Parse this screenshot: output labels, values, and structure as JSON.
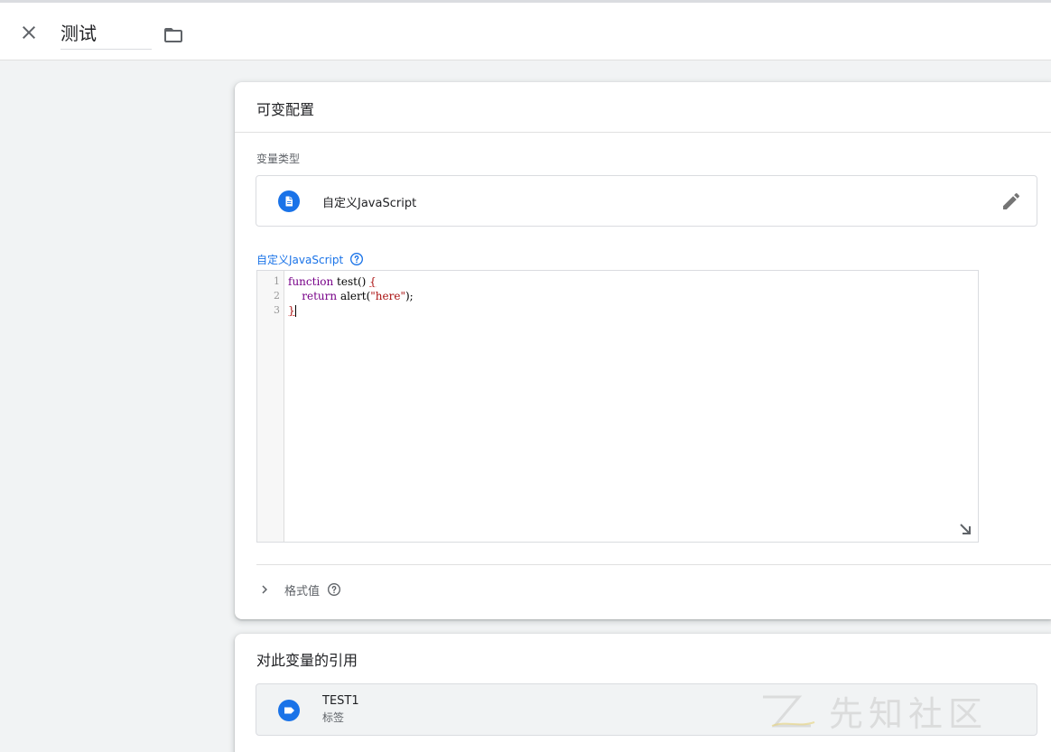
{
  "header": {
    "title_value": "测试",
    "close_icon": "close-icon",
    "folder_icon": "folder-icon"
  },
  "config_card": {
    "title": "可变配置",
    "variable_type_label": "变量类型",
    "variable_type_name": "自定义JavaScript",
    "type_icon": "document-icon",
    "edit_icon": "pencil-icon",
    "js_label": "自定义JavaScript",
    "help_icon": "help-icon",
    "code": {
      "line_numbers": [
        "1",
        "2",
        "3"
      ],
      "line1_fn": "function",
      "line1_name": " test() ",
      "line1_brace": "{",
      "line2_indent": "    ",
      "line2_return": "return",
      "line2_call": " alert(",
      "line2_string": "\"here\"",
      "line2_end": ");",
      "line3_brace": "}"
    },
    "format_label": "格式值"
  },
  "references_card": {
    "title": "对此变量的引用",
    "items": [
      {
        "name": "TEST1",
        "type": "标签",
        "icon": "tag-icon"
      }
    ]
  },
  "watermark": {
    "text": "先知社区"
  },
  "colors": {
    "accent_blue": "#1a73e8",
    "page_background": "#f1f3f4",
    "keyword_purple": "#770088",
    "string_red": "#aa1111"
  }
}
